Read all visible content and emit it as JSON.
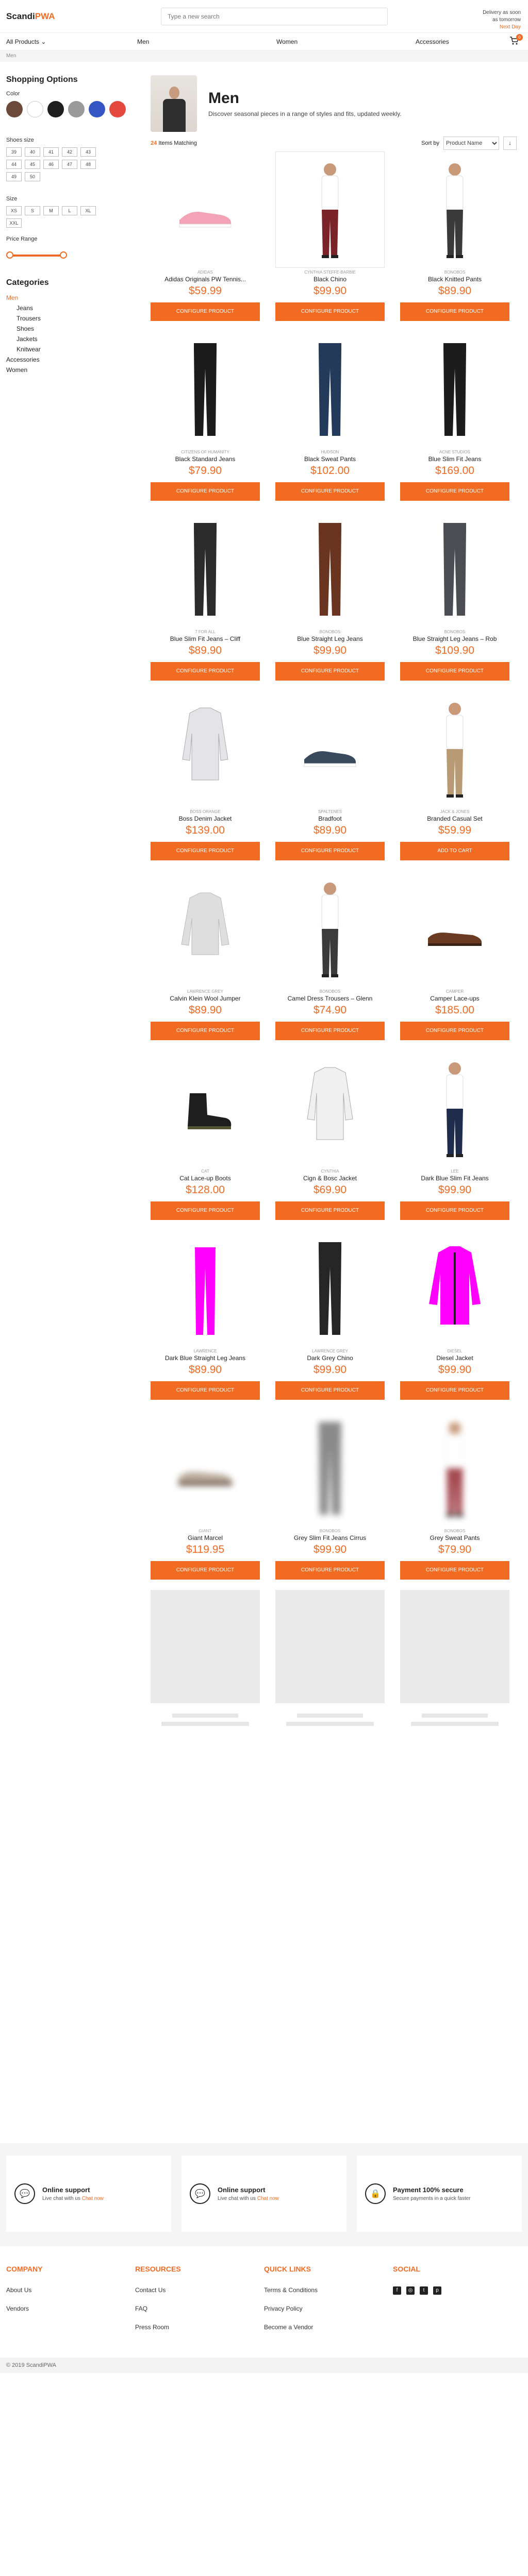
{
  "header": {
    "logo_main": "Scandi",
    "logo_accent": "PWA",
    "search_placeholder": "Type a new search",
    "delivery_line1": "Delivery as soon",
    "delivery_line2": "as tomorrow",
    "delivery_link": "Next Day",
    "cart_count": "0"
  },
  "nav": {
    "all_products": "All Products",
    "items": [
      "Men",
      "Women",
      "Accessories"
    ]
  },
  "breadcrumb": "Men",
  "sidebar": {
    "title": "Shopping Options",
    "color_label": "Color",
    "colors": [
      "#6b4a3a",
      "#ffffff",
      "#1e1e1e",
      "#9a9a9a",
      "#3557c4",
      "#e34a3d"
    ],
    "shoe_size_label": "Shoes size",
    "shoe_sizes": [
      "39",
      "40",
      "41",
      "42",
      "43",
      "44",
      "45",
      "46",
      "47",
      "48",
      "49",
      "50"
    ],
    "size_label": "Size",
    "sizes": [
      "XS",
      "S",
      "M",
      "L",
      "XL",
      "XXL"
    ],
    "price_label": "Price Range",
    "price_range": {
      "min_fraction": 0.0,
      "max_fraction": 1.0
    },
    "categories_title": "Categories",
    "categories": [
      {
        "label": "Men",
        "active": true,
        "sub": false
      },
      {
        "label": "Jeans",
        "active": false,
        "sub": true
      },
      {
        "label": "Trousers",
        "active": false,
        "sub": true
      },
      {
        "label": "Shoes",
        "active": false,
        "sub": true
      },
      {
        "label": "Jackets",
        "active": false,
        "sub": true
      },
      {
        "label": "Knitwear",
        "active": false,
        "sub": true
      },
      {
        "label": "Accessories",
        "active": false,
        "sub": false
      },
      {
        "label": "Women",
        "active": false,
        "sub": false
      }
    ]
  },
  "category": {
    "title": "Men",
    "description": "Discover seasonal pieces in a range of styles and fits, updated weekly.",
    "count": "24",
    "count_text": "Items Matching",
    "sort_label": "Sort by",
    "sort_selected": "Product Name",
    "sort_direction": "↓"
  },
  "products": [
    {
      "brand": "Adidas",
      "title": "Adidas Originals PW Tennis...",
      "price": "$59.99",
      "button": "CONFIGURE PRODUCT",
      "kind": "sneaker",
      "color": "#f2a3b6"
    },
    {
      "brand": "Cynthia Steffe-Barbie",
      "title": "Black Chino",
      "price": "$99.90",
      "button": "CONFIGURE PRODUCT",
      "kind": "person",
      "color": "#7a2328"
    },
    {
      "brand": "Bonobos",
      "title": "Black Knitted Pants",
      "price": "$89.90",
      "button": "CONFIGURE PRODUCT",
      "kind": "person",
      "color": "#3a3a3a"
    },
    {
      "brand": "Citizens Of Humanity",
      "title": "Black Standard Jeans",
      "price": "$79.90",
      "button": "CONFIGURE PRODUCT",
      "kind": "pants",
      "color": "#1b1b1b"
    },
    {
      "brand": "Hudson",
      "title": "Black Sweat Pants",
      "price": "$102.00",
      "button": "CONFIGURE PRODUCT",
      "kind": "pants",
      "color": "#233a5a"
    },
    {
      "brand": "Acne Studios",
      "title": "Blue Slim Fit Jeans",
      "price": "$169.00",
      "button": "CONFIGURE PRODUCT",
      "kind": "pants",
      "color": "#1c1c1c"
    },
    {
      "brand": "7 For All",
      "title": "Blue Slim Fit Jeans – Cliff",
      "price": "$89.90",
      "button": "CONFIGURE PRODUCT",
      "kind": "pants",
      "color": "#2b2b2b"
    },
    {
      "brand": "Bonobos",
      "title": "Blue Straight Leg Jeans",
      "price": "$99.90",
      "button": "CONFIGURE PRODUCT",
      "kind": "pants",
      "color": "#6a3520"
    },
    {
      "brand": "Bonobos",
      "title": "Blue Straight Leg Jeans – Rob",
      "price": "$109.90",
      "button": "CONFIGURE PRODUCT",
      "kind": "pants",
      "color": "#4a4d52"
    },
    {
      "brand": "Boss Orange",
      "title": "Boss Denim Jacket",
      "price": "$139.00",
      "button": "CONFIGURE PRODUCT",
      "kind": "jacket",
      "color": "#e4e4e8"
    },
    {
      "brand": "Spaltenes",
      "title": "Bradfoot",
      "price": "$89.90",
      "button": "CONFIGURE PRODUCT",
      "kind": "sneaker",
      "color": "#3a4a5e"
    },
    {
      "brand": "Jack & Jones",
      "title": "Branded Casual Set",
      "price": "$59.99",
      "button": "ADD TO CART",
      "kind": "person",
      "color": "#b89a74"
    },
    {
      "brand": "Lawrence Grey",
      "title": "Calvin Klein Wool Jumper",
      "price": "$89.90",
      "button": "CONFIGURE PRODUCT",
      "kind": "jumper",
      "color": "#dedede"
    },
    {
      "brand": "Bonobos",
      "title": "Camel Dress Trousers – Glenn",
      "price": "$74.90",
      "button": "CONFIGURE PRODUCT",
      "kind": "person",
      "color": "#3b3b3b"
    },
    {
      "brand": "Camper",
      "title": "Camper Lace-ups",
      "price": "$185.00",
      "button": "CONFIGURE PRODUCT",
      "kind": "shoe",
      "color": "#6b3a22"
    },
    {
      "brand": "Cat",
      "title": "Cat Lace-up Boots",
      "price": "$128.00",
      "button": "CONFIGURE PRODUCT",
      "kind": "boot",
      "color": "#1e1e1e"
    },
    {
      "brand": "Cynthia",
      "title": "Cign & Bosc Jacket",
      "price": "$69.90",
      "button": "CONFIGURE PRODUCT",
      "kind": "jacket",
      "color": "#f0f0f0"
    },
    {
      "brand": "Lee",
      "title": "Dark Blue Slim Fit Jeans",
      "price": "$99.90",
      "button": "CONFIGURE PRODUCT",
      "kind": "person",
      "color": "#1f2b4a"
    },
    {
      "brand": "Lawrence",
      "title": "Dark Blue Straight Leg Jeans",
      "price": "$89.90",
      "button": "CONFIGURE PRODUCT",
      "kind": "magenta",
      "color": "#ff00ff"
    },
    {
      "brand": "Lawrence Grey",
      "title": "Dark Grey Chino",
      "price": "$99.90",
      "button": "CONFIGURE PRODUCT",
      "kind": "pants",
      "color": "#262626"
    },
    {
      "brand": "Diesel",
      "title": "Diesel Jacket",
      "price": "$99.90",
      "button": "CONFIGURE PRODUCT",
      "kind": "magentajacket",
      "color": "#ff00ff"
    },
    {
      "brand": "Giant",
      "title": "Giant Marcel",
      "price": "$119.95",
      "button": "CONFIGURE PRODUCT",
      "kind": "blur-shoe",
      "color": "#b8a99a"
    },
    {
      "brand": "Bonobos",
      "title": "Grey Slim Fit Jeans Cirrus",
      "price": "$99.90",
      "button": "CONFIGURE PRODUCT",
      "kind": "blur-pants",
      "color": "#8a8a8a"
    },
    {
      "brand": "Bonobos",
      "title": "Grey Sweat Pants",
      "price": "$79.90",
      "button": "CONFIGURE PRODUCT",
      "kind": "blur-person",
      "color": "#a54a52"
    }
  ],
  "support": [
    {
      "title": "Online support",
      "text": "Live chat with us",
      "link": "Chat now",
      "icon": "chat-icon"
    },
    {
      "title": "Online support",
      "text": "Live chat with us",
      "link": "Chat now",
      "icon": "chat-icon"
    },
    {
      "title": "Payment 100% secure",
      "text": "Secure payments in a quick faster",
      "link": "",
      "icon": "lock-icon"
    }
  ],
  "footer": {
    "columns": [
      {
        "head": "COMPANY",
        "links": [
          "About Us",
          "Vendors"
        ]
      },
      {
        "head": "RESOURCES",
        "links": [
          "Contact Us",
          "FAQ",
          "Press Room"
        ]
      },
      {
        "head": "QUICK LINKS",
        "links": [
          "Terms & Conditions",
          "Privacy Policy",
          "Become a Vendor"
        ]
      },
      {
        "head": "SOCIAL",
        "links": []
      }
    ],
    "social_icons": [
      "f",
      "◎",
      "t",
      "p"
    ],
    "copyright": "© 2019 ScandiPWA"
  }
}
